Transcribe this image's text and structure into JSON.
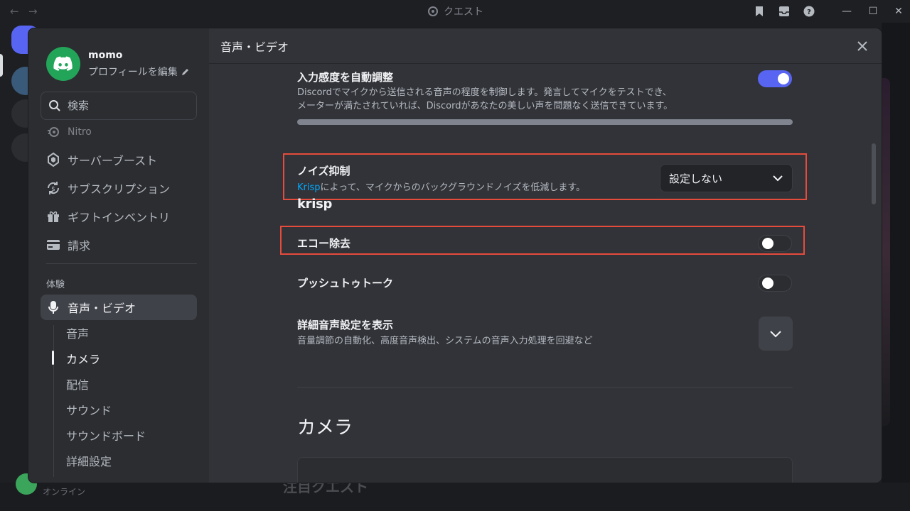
{
  "titlebar": {
    "title": "クエスト",
    "back_arrow": "←",
    "forward_arrow": "→",
    "minimize": "—",
    "maximize": "☐",
    "close": "✕"
  },
  "background": {
    "quest_heading": "注目クエスト",
    "status": "オンライン"
  },
  "profile": {
    "name": "momo",
    "edit_label": "プロフィールを編集"
  },
  "search": {
    "placeholder": "検索"
  },
  "nav": {
    "items": [
      {
        "label": "Nitro",
        "icon": "nitro-icon"
      },
      {
        "label": "サーバーブースト",
        "icon": "boost-icon"
      },
      {
        "label": "サブスクリプション",
        "icon": "subscription-icon"
      },
      {
        "label": "ギフトインベントリ",
        "icon": "gift-icon"
      },
      {
        "label": "請求",
        "icon": "card-icon"
      }
    ],
    "section_label": "体験",
    "active_item": {
      "label": "音声・ビデオ",
      "icon": "microphone-icon"
    },
    "sub_items": [
      "音声",
      "カメラ",
      "配信",
      "サウンド",
      "サウンドボード",
      "詳細設定"
    ]
  },
  "header": {
    "title": "音声・ビデオ"
  },
  "settings": {
    "auto_sensitivity": {
      "title": "入力感度を自動調整",
      "desc_line1": "Discordでマイクから送信される音声の程度を制御します。発言してマイクをテストでき、",
      "desc_line2": "メーターが満たされていれば、Discordがあなたの美しい声を問題なく送信できています。",
      "enabled": true
    },
    "noise_suppression": {
      "title": "ノイズ抑制",
      "desc_link": "Krisp",
      "desc_rest": "によって、マイクからのバックグラウンドノイズを低減します。",
      "selected": "設定しない",
      "brand": "krisp"
    },
    "echo_cancellation": {
      "title": "エコー除去",
      "enabled": false
    },
    "push_to_talk": {
      "title": "プッシュトゥトーク",
      "enabled": false
    },
    "advanced": {
      "title": "詳細音声設定を表示",
      "desc": "音量調節の自動化、高度音声検出、システムの音声入力処理を回避など"
    }
  },
  "camera": {
    "heading": "カメラ"
  },
  "colors": {
    "accent": "#5865f2",
    "highlight": "#e64b3c",
    "link": "#00a8fc",
    "online": "#23a559"
  }
}
